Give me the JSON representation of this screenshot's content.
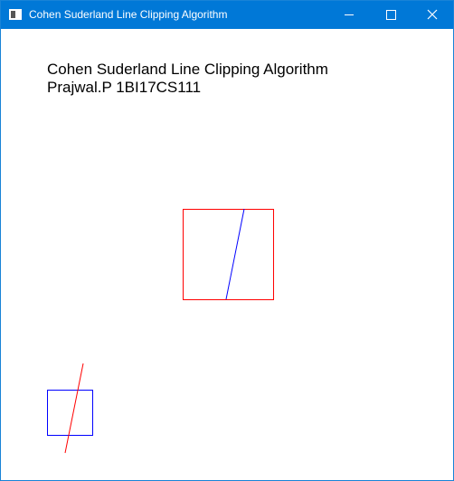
{
  "window": {
    "title": "Cohen Suderland Line Clipping Algorithm",
    "controls": {
      "minimize_icon": "minimize-icon",
      "maximize_icon": "maximize-icon",
      "close_icon": "close-icon"
    },
    "colors": {
      "titlebar": "#0078d7",
      "border": "#1883d7",
      "background": "#ffffff"
    }
  },
  "canvas": {
    "heading": {
      "line1": "Cohen Suderland Line Clipping Algorithm",
      "line2": "Prajwal.P 1BI17CS111"
    },
    "colors": {
      "clip_window": "#ff0000",
      "clipped_line": "#0000ff",
      "original_window": "#0000ff",
      "original_line": "#ff0000"
    }
  }
}
